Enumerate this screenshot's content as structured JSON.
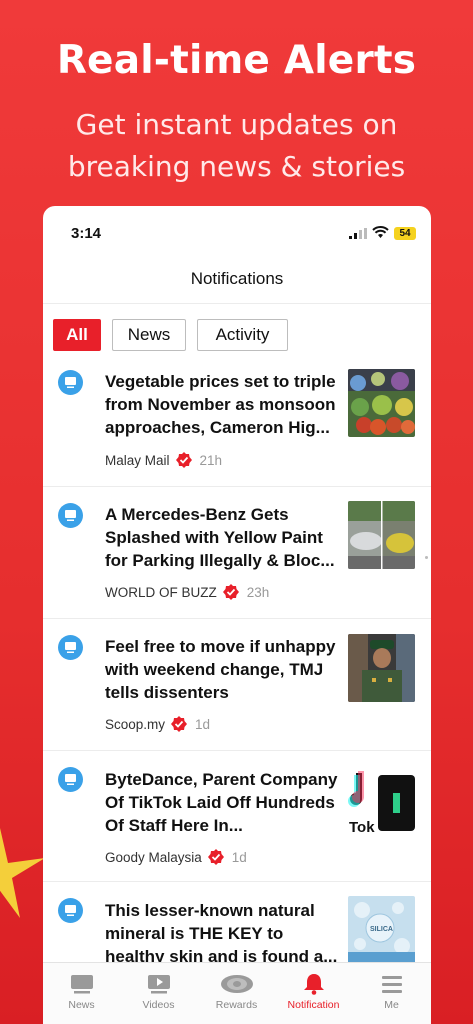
{
  "promo": {
    "headline": "Real-time Alerts",
    "subline_1": "Get instant updates on",
    "subline_2": "breaking news & stories"
  },
  "status_bar": {
    "time": "3:14",
    "battery": "54"
  },
  "header": {
    "title": "Notifications"
  },
  "tabs": [
    {
      "label": "All",
      "active": true
    },
    {
      "label": "News",
      "active": false
    },
    {
      "label": "Activity",
      "active": false
    }
  ],
  "notifications": [
    {
      "title": "Vegetable prices set to triple from November as monsoon approaches, Cameron Hig...",
      "source": "Malay Mail",
      "verified": true,
      "time": "21h"
    },
    {
      "title": "A Mercedes-Benz Gets Splashed with Yellow Paint for Parking Illegally & Bloc...",
      "source": "WORLD OF BUZZ",
      "verified": true,
      "time": "23h"
    },
    {
      "title": "Feel free to move if unhappy with weekend change, TMJ tells dissenters",
      "source": "Scoop.my",
      "verified": true,
      "time": "1d"
    },
    {
      "title": "ByteDance, Parent Company Of TikTok Laid Off Hundreds Of Staff Here In...",
      "source": "Goody Malaysia",
      "verified": true,
      "time": "1d"
    },
    {
      "title": "This lesser-known natural mineral is THE KEY to healthy skin and is found a...",
      "source": "",
      "verified": false,
      "time": ""
    }
  ],
  "thumb_texts": {
    "tiktok": "Tok",
    "silica": "SILICA"
  },
  "bottom_nav": [
    {
      "label": "News",
      "icon": "news-icon",
      "active": false
    },
    {
      "label": "Videos",
      "icon": "video-icon",
      "active": false
    },
    {
      "label": "Rewards",
      "icon": "rewards-icon",
      "active": false
    },
    {
      "label": "Notification",
      "icon": "bell-icon",
      "active": true
    },
    {
      "label": "Me",
      "icon": "menu-icon",
      "active": false
    }
  ],
  "colors": {
    "brand_red": "#e8202a",
    "background_red": "#e62e2e",
    "notification_dot": "#3aa1e8",
    "verified_badge": "#e8202a"
  }
}
